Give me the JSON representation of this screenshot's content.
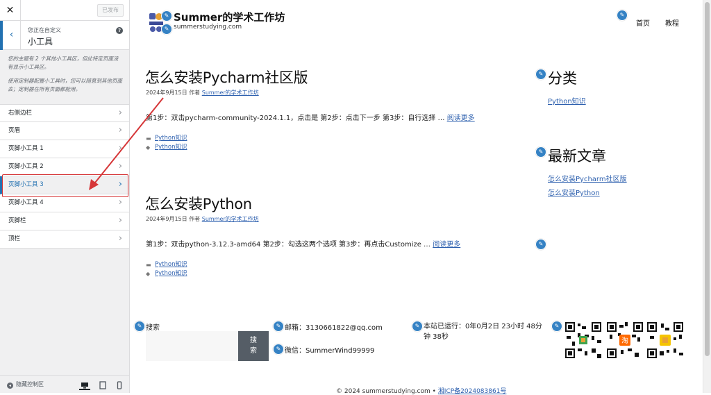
{
  "customizer": {
    "close": "✕",
    "publish": "已发布",
    "back": "‹",
    "subtitle": "您正在自定义",
    "title": "小工具",
    "help": "?",
    "notes": [
      "您的主题有 2 个其他小工具区，但此特定页面没有显示小工具区。",
      "使用定制器配置小工具时，您可以随意到其他页面去；定制器在所有页面都能用。"
    ],
    "areas": [
      {
        "label": "右侧边栏"
      },
      {
        "label": "页眉"
      },
      {
        "label": "页脚小工具 1"
      },
      {
        "label": "页脚小工具 2"
      },
      {
        "label": "页脚小工具 3"
      },
      {
        "label": "页脚小工具 4"
      },
      {
        "label": "页脚栏"
      },
      {
        "label": "顶栏"
      }
    ],
    "active_area": "页脚小工具 3",
    "hide_controls": "隐藏控制区",
    "devices": [
      "desktop-icon",
      "tablet-icon",
      "mobile-icon"
    ],
    "active_device": "desktop"
  },
  "site": {
    "title": "Summer的学术工作坊",
    "description": "summerstudying.com",
    "nav": [
      "首页",
      "教程"
    ]
  },
  "posts": [
    {
      "title": "怎么安装Pycharm社区版",
      "date": "2024年9月15日",
      "by": "作者",
      "author": "Summer的学术工作坊",
      "excerpt": "第1步：双击pycharm-community-2024.1.1，点击是 第2步：点击下一步 第3步：自行选择 …",
      "read_more": "阅读更多",
      "category": "Python知识",
      "tag": "Python知识"
    },
    {
      "title": "怎么安装Python",
      "date": "2024年9月15日",
      "by": "作者",
      "author": "Summer的学术工作坊",
      "excerpt": "第1步：双击python-3.12.3-amd64 第2步：勾选这两个选项 第3步：再点击Customize …",
      "read_more": "阅读更多",
      "category": "Python知识",
      "tag": "Python知识"
    }
  ],
  "sidebar": {
    "categories_title": "分类",
    "categories": [
      "Python知识"
    ],
    "recent_title": "最新文章",
    "recent": [
      "怎么安装Pycharm社区版",
      "怎么安装Python"
    ]
  },
  "footer": {
    "search_label": "搜索",
    "search_button": "搜索",
    "email": "邮箱：3130661822@qq.com",
    "wechat": "微信：SummerWind99999",
    "uptime": "本站已运行：0年0月2日 23小时 48分钟 38秒",
    "copyright": "© 2024 summerstudying.com •",
    "icp": "湘ICP备2024083861号"
  },
  "colors": {
    "accent": "#2271b1",
    "link": "#2c5fae",
    "annotation": "#d63638",
    "pencil": "#3582c4"
  }
}
